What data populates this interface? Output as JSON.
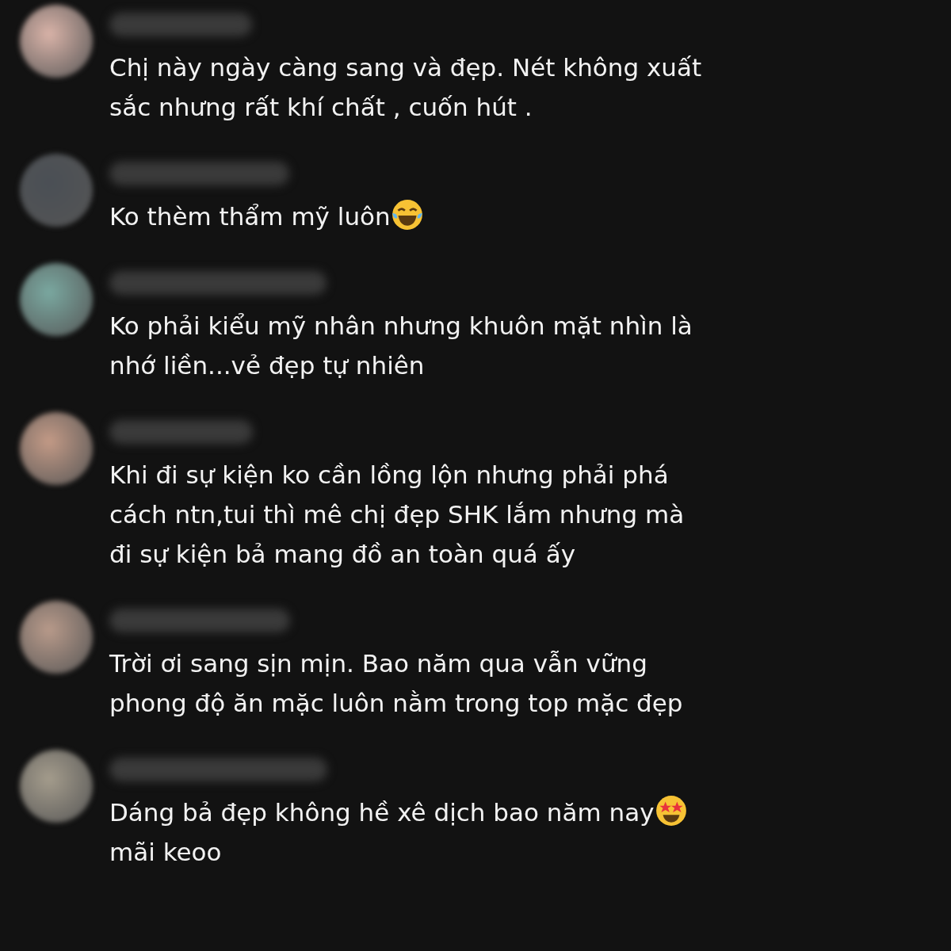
{
  "comments": [
    {
      "parts": [
        {
          "kind": "text",
          "text": "Chị này ngày càng sang và đẹp. Nét không xuất sắc nhưng rất khí chất , cuốn hút ."
        }
      ]
    },
    {
      "parts": [
        {
          "kind": "text",
          "text": " Ko thèm thẩm mỹ luôn"
        },
        {
          "kind": "laughing-emoji"
        }
      ]
    },
    {
      "parts": [
        {
          "kind": "text",
          "text": "Ko phải kiểu mỹ nhân nhưng khuôn mặt nhìn là nhớ liền...vẻ đẹp tự nhiên"
        }
      ]
    },
    {
      "parts": [
        {
          "kind": "text",
          "text": "Khi đi sự kiện ko cần lồng lộn nhưng phải phá cách ntn,tui thì mê chị đẹp SHK lắm nhưng mà đi sự kiện bả mang đồ an toàn quá ấy"
        }
      ]
    },
    {
      "parts": [
        {
          "kind": "text",
          "text": "Trời ơi sang sịn mịn. Bao năm qua vẫn vững phong độ ăn mặc luôn nằm trong top mặc đẹp"
        }
      ]
    },
    {
      "parts": [
        {
          "kind": "text",
          "text": "Dáng bả đẹp không hề xê dịch bao năm nay"
        },
        {
          "kind": "star-eyes-emoji"
        },
        {
          "kind": "text",
          "text": " mãi keoo"
        }
      ]
    }
  ]
}
